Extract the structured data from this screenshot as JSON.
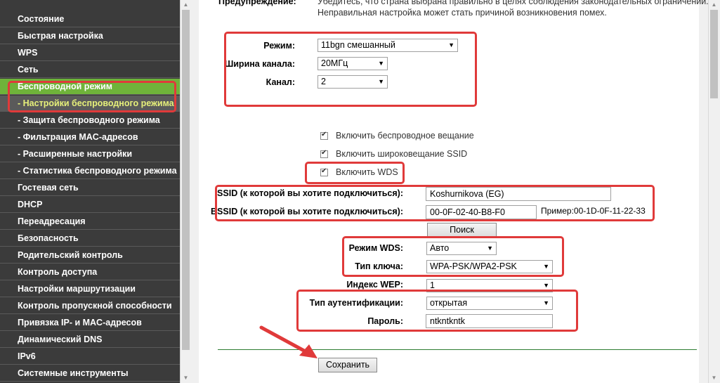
{
  "sidebar": {
    "items": [
      {
        "label": "Состояние",
        "type": "main"
      },
      {
        "label": "Быстрая настройка",
        "type": "main"
      },
      {
        "label": "WPS",
        "type": "main"
      },
      {
        "label": "Сеть",
        "type": "main"
      },
      {
        "label": "Беспроводной режим",
        "type": "active-parent"
      },
      {
        "label": "- Настройки беспроводного режима",
        "type": "active-sub"
      },
      {
        "label": "- Защита беспроводного режима",
        "type": "sub"
      },
      {
        "label": "- Фильтрация MAC-адресов",
        "type": "sub"
      },
      {
        "label": "- Расширенные настройки",
        "type": "sub"
      },
      {
        "label": "- Статистика беспроводного режима",
        "type": "sub"
      },
      {
        "label": "Гостевая сеть",
        "type": "main"
      },
      {
        "label": "DHCP",
        "type": "main"
      },
      {
        "label": "Переадресация",
        "type": "main"
      },
      {
        "label": "Безопасность",
        "type": "main"
      },
      {
        "label": "Родительский контроль",
        "type": "main"
      },
      {
        "label": "Контроль доступа",
        "type": "main"
      },
      {
        "label": "Настройки маршрутизации",
        "type": "main"
      },
      {
        "label": "Контроль пропускной способности",
        "type": "main"
      },
      {
        "label": "Привязка IP- и MAC-адресов",
        "type": "main"
      },
      {
        "label": "Динамический DNS",
        "type": "main"
      },
      {
        "label": "IPv6",
        "type": "main"
      },
      {
        "label": "Системные инструменты",
        "type": "main"
      }
    ]
  },
  "warning": {
    "label": "Предупреждение:",
    "line1": "Убедитесь, что страна выбрана правильно в целях соблюдения законодательных ограничений.",
    "line2": "Неправильная настройка может стать причиной возникновения помех."
  },
  "mode": {
    "label": "Режим:",
    "value": "11bgn смешанный"
  },
  "channel_width": {
    "label": "Ширина канала:",
    "value": "20МГц"
  },
  "channel": {
    "label": "Канал:",
    "value": "2"
  },
  "checkboxes": {
    "broadcast": {
      "label": "Включить беспроводное вещание",
      "checked": true
    },
    "ssid_broadcast": {
      "label": "Включить широковещание SSID",
      "checked": true
    },
    "wds": {
      "label": "Включить WDS",
      "checked": true
    }
  },
  "ssid": {
    "label": "SSID (к которой вы хотите подключиться):",
    "value": "Koshurnikova (EG)"
  },
  "bssid": {
    "label": "BSSID (к которой вы хотите подключиться):",
    "value": "00-0F-02-40-B8-F0",
    "example": "Пример:00-1D-0F-11-22-33"
  },
  "search_button": "Поиск",
  "wds_mode": {
    "label": "Режим WDS:",
    "value": "Авто"
  },
  "key_type": {
    "label": "Тип ключа:",
    "value": "WPA-PSK/WPA2-PSK"
  },
  "wep_index": {
    "label": "Индекс WEP:",
    "value": "1"
  },
  "auth_type": {
    "label": "Тип аутентификации:",
    "value": "открытая"
  },
  "password": {
    "label": "Пароль:",
    "value": "ntkntkntk"
  },
  "save_button": "Сохранить",
  "colors": {
    "annotation": "#e03a3a",
    "active_menu": "#6fb33a",
    "sidebar_bg": "#3b3b3b"
  }
}
